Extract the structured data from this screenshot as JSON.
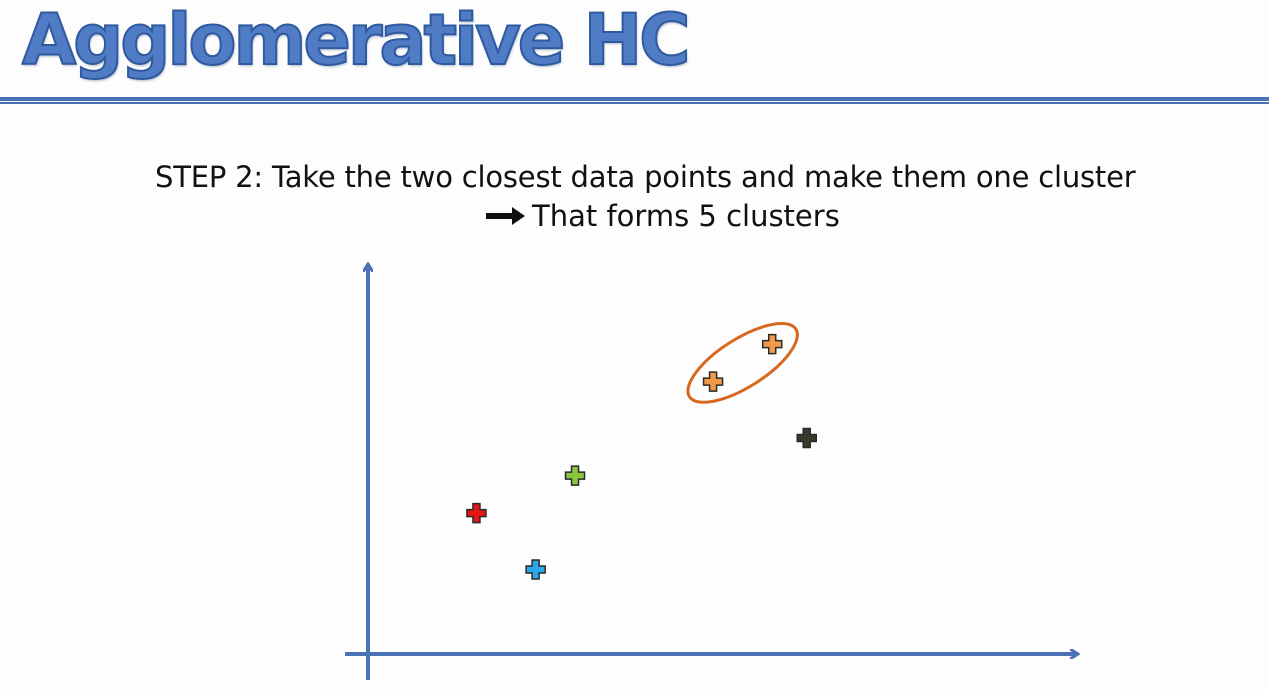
{
  "slide": {
    "title": "Agglomerative HC",
    "step_text": "STEP 2: Take the two closest data points and make them one cluster",
    "result_text": "That forms 5 clusters",
    "arrow_icon": "right-arrow-icon"
  },
  "colors": {
    "title": "#4f7cc4",
    "rule": "#4a72b5",
    "axis": "#4a72b5",
    "cluster_outline": "#d8681e"
  },
  "chart_data": {
    "type": "scatter",
    "points": [
      {
        "x": 1.1,
        "y": 1.5,
        "color": "#e81515",
        "marker": "plus"
      },
      {
        "x": 1.7,
        "y": 0.9,
        "color": "#2aa8e8",
        "marker": "plus"
      },
      {
        "x": 2.1,
        "y": 1.9,
        "color": "#8cc63e",
        "marker": "plus"
      },
      {
        "x": 3.5,
        "y": 2.9,
        "color": "#f39a4a",
        "marker": "plus"
      },
      {
        "x": 4.1,
        "y": 3.3,
        "color": "#f39a4a",
        "marker": "plus"
      },
      {
        "x": 4.45,
        "y": 2.3,
        "color": "#3a3a2c",
        "marker": "plus"
      }
    ],
    "clusters": [
      {
        "members": [
          3,
          4
        ],
        "outline_color": "#d8681e"
      }
    ],
    "xlim": [
      0,
      7.1
    ],
    "ylim": [
      0,
      4.1
    ],
    "grid": false
  }
}
